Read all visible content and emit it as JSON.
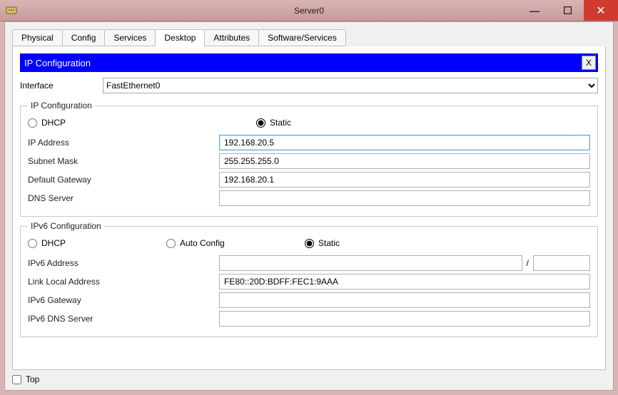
{
  "window": {
    "title": "Server0"
  },
  "tabs": [
    "Physical",
    "Config",
    "Services",
    "Desktop",
    "Attributes",
    "Software/Services"
  ],
  "active_tab": "Desktop",
  "panel": {
    "title": "IP Configuration",
    "close_label": "X"
  },
  "interface": {
    "label": "Interface",
    "selected": "FastEthernet0"
  },
  "ipv4": {
    "legend": "IP Configuration",
    "dhcp_label": "DHCP",
    "static_label": "Static",
    "mode": "static",
    "ip_label": "IP Address",
    "ip_value": "192.168.20.5",
    "mask_label": "Subnet Mask",
    "mask_value": "255.255.255.0",
    "gateway_label": "Default Gateway",
    "gateway_value": "192.168.20.1",
    "dns_label": "DNS Server",
    "dns_value": ""
  },
  "ipv6": {
    "legend": "IPv6 Configuration",
    "dhcp_label": "DHCP",
    "auto_label": "Auto Config",
    "static_label": "Static",
    "mode": "static",
    "addr_label": "IPv6 Address",
    "addr_value": "",
    "prefix_value": "",
    "slash": "/",
    "lla_label": "Link Local Address",
    "lla_value": "FE80::20D:BDFF:FEC1:9AAA",
    "gateway_label": "IPv6 Gateway",
    "gateway_value": "",
    "dns_label": "IPv6 DNS Server",
    "dns_value": ""
  },
  "bottom": {
    "top_label": "Top",
    "top_checked": false
  }
}
